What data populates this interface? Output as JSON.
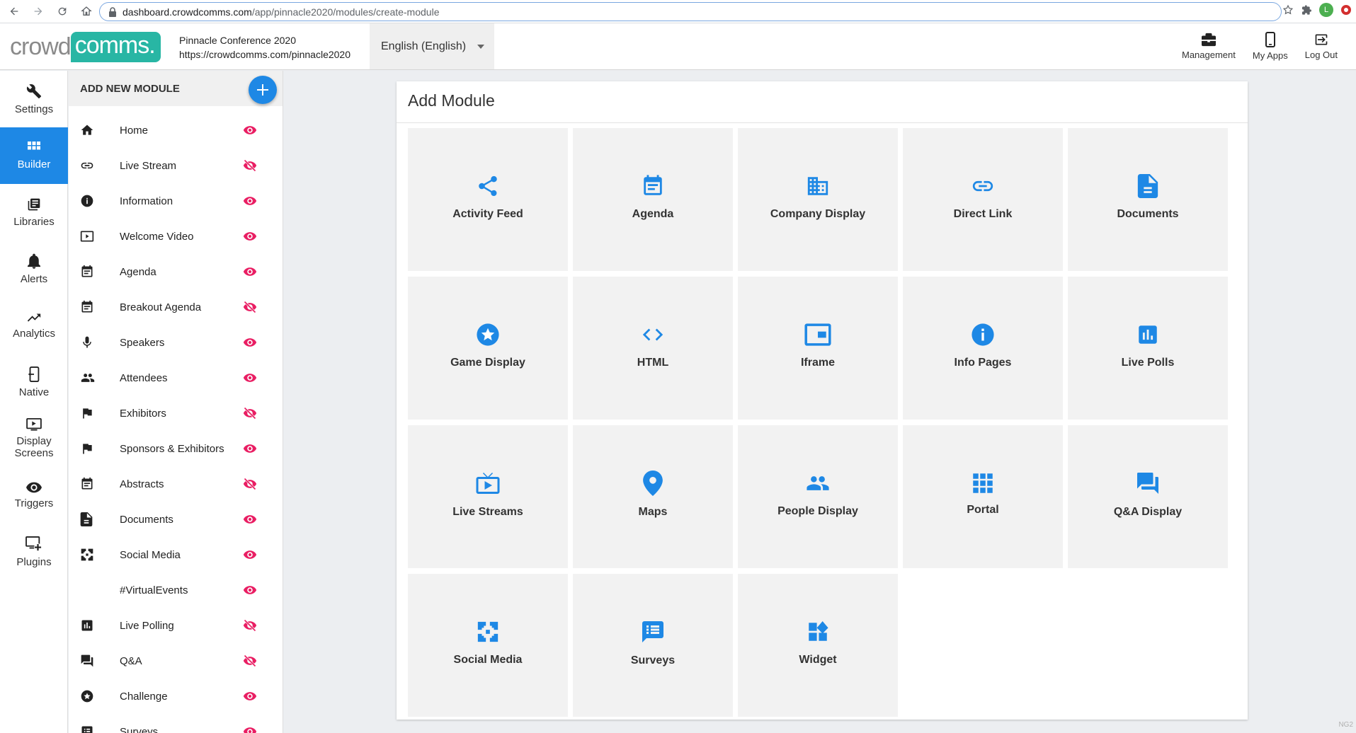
{
  "browser": {
    "url_host": "dashboard.crowdcomms.com",
    "url_path": "/app/pinnacle2020/modules/create-module",
    "avatar_letter": "L"
  },
  "header": {
    "logo_left": "crowd",
    "logo_right": "comms.",
    "event_name": "Pinnacle Conference 2020",
    "event_url": "https://crowdcomms.com/pinnacle2020",
    "language": "English (English)",
    "actions": [
      {
        "label": "Management",
        "icon": "briefcase-icon"
      },
      {
        "label": "My Apps",
        "icon": "phone-icon"
      },
      {
        "label": "Log Out",
        "icon": "logout-icon"
      }
    ]
  },
  "rail": {
    "items": [
      {
        "label": "Settings",
        "icon": "wrench-icon"
      },
      {
        "label": "Builder",
        "icon": "grid-icon",
        "active": true
      },
      {
        "label": "Libraries",
        "icon": "library-icon"
      },
      {
        "label": "Alerts",
        "icon": "bell-icon"
      },
      {
        "label": "Analytics",
        "icon": "trending-icon"
      },
      {
        "label": "Native",
        "icon": "native-icon"
      },
      {
        "label": "Display Screens",
        "icon": "display-icon"
      },
      {
        "label": "Triggers",
        "icon": "eye-icon"
      },
      {
        "label": "Plugins",
        "icon": "plugins-icon"
      }
    ]
  },
  "panel": {
    "title": "ADD NEW MODULE",
    "modules": [
      {
        "label": "Home",
        "icon": "home-icon",
        "visible": true
      },
      {
        "label": "Live Stream",
        "icon": "link-icon",
        "visible": false
      },
      {
        "label": "Information",
        "icon": "info-icon",
        "visible": true
      },
      {
        "label": "Welcome Video",
        "icon": "video-icon",
        "visible": true
      },
      {
        "label": "Agenda",
        "icon": "calendar-icon",
        "visible": true
      },
      {
        "label": "Breakout Agenda",
        "icon": "calendar-icon",
        "visible": false
      },
      {
        "label": "Speakers",
        "icon": "mic-icon",
        "visible": true
      },
      {
        "label": "Attendees",
        "icon": "people-icon",
        "visible": true
      },
      {
        "label": "Exhibitors",
        "icon": "flag-icon",
        "visible": false
      },
      {
        "label": "Sponsors & Exhibitors",
        "icon": "flag-icon",
        "visible": true
      },
      {
        "label": "Abstracts",
        "icon": "calendar-icon",
        "visible": false
      },
      {
        "label": "Documents",
        "icon": "document-icon",
        "visible": true
      },
      {
        "label": "Social Media",
        "icon": "social-icon",
        "visible": true
      },
      {
        "label": "#VirtualEvents",
        "icon": "",
        "visible": true
      },
      {
        "label": "Live Polling",
        "icon": "poll-icon",
        "visible": false
      },
      {
        "label": "Q&A",
        "icon": "forum-icon",
        "visible": false
      },
      {
        "label": "Challenge",
        "icon": "star-icon",
        "visible": true
      },
      {
        "label": "Surveys",
        "icon": "survey-icon",
        "visible": true
      }
    ]
  },
  "main": {
    "title": "Add Module",
    "tiles": [
      {
        "label": "Activity Feed",
        "icon": "share-icon"
      },
      {
        "label": "Agenda",
        "icon": "calendar-icon"
      },
      {
        "label": "Company Display",
        "icon": "building-icon"
      },
      {
        "label": "Direct Link",
        "icon": "link-icon"
      },
      {
        "label": "Documents",
        "icon": "document-icon"
      },
      {
        "label": "Game Display",
        "icon": "star-icon"
      },
      {
        "label": "HTML",
        "icon": "code-icon"
      },
      {
        "label": "Iframe",
        "icon": "iframe-icon"
      },
      {
        "label": "Info Pages",
        "icon": "info-icon"
      },
      {
        "label": "Live Polls",
        "icon": "poll-icon"
      },
      {
        "label": "Live Streams",
        "icon": "tv-icon"
      },
      {
        "label": "Maps",
        "icon": "pin-icon"
      },
      {
        "label": "People Display",
        "icon": "people-icon"
      },
      {
        "label": "Portal",
        "icon": "apps-icon"
      },
      {
        "label": "Q&A Display",
        "icon": "forum-icon"
      },
      {
        "label": "Social Media",
        "icon": "social-icon"
      },
      {
        "label": "Surveys",
        "icon": "survey-icon"
      },
      {
        "label": "Widget",
        "icon": "widget-icon"
      }
    ],
    "tag": "NG2"
  },
  "colors": {
    "accent": "#1e88e5",
    "eye": "#e91e63",
    "brand": "#28b6a4"
  }
}
